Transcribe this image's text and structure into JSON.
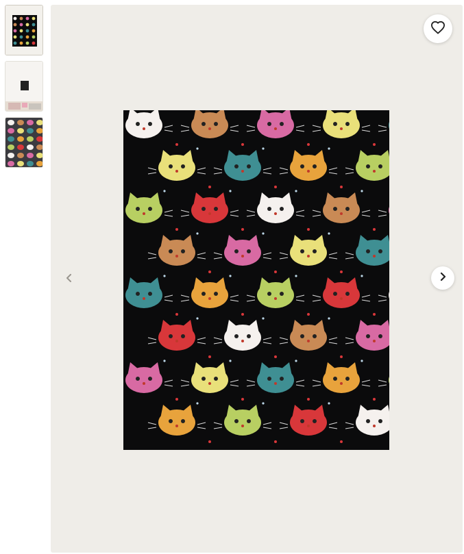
{
  "gallery": {
    "thumbnails": [
      {
        "name": "cat-pattern-poster-thumbnail",
        "selected": true
      },
      {
        "name": "room-mockup-thumbnail",
        "selected": false
      },
      {
        "name": "pattern-closeup-thumbnail",
        "selected": false
      }
    ]
  },
  "viewer": {
    "favorite_icon": "heart-icon",
    "next_icon": "chevron-right-icon",
    "prev_icon": "chevron-left-icon"
  },
  "artwork": {
    "description_icon": "cat-faces-pattern",
    "background_color": "#0b0b0c"
  },
  "colors": {
    "stage_background": "#efede8",
    "cat_orange": "#e8a33c",
    "cat_pink": "#d86aa3",
    "cat_green": "#b8cf62",
    "cat_teal": "#3f8f93",
    "cat_red": "#d8373a",
    "cat_white": "#f5f1ee",
    "cat_yellow": "#e9e07a",
    "cat_brown": "#c98a55"
  }
}
